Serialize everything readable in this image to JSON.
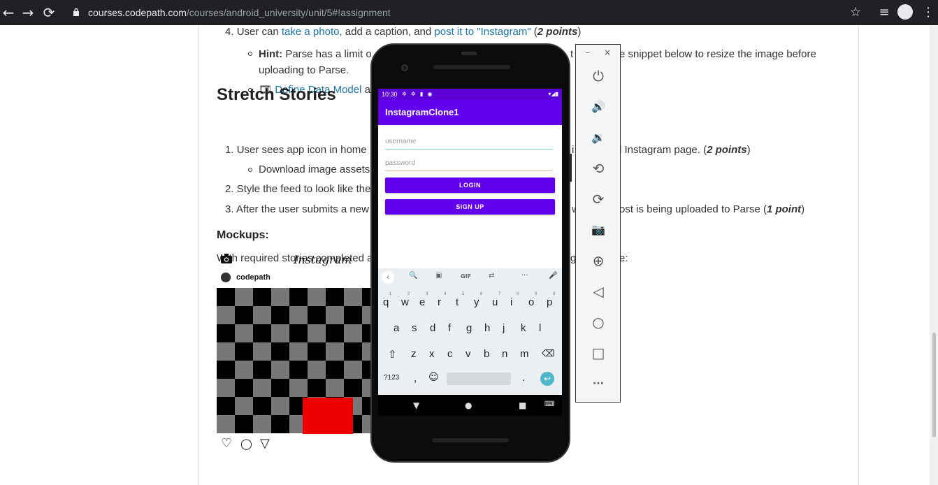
{
  "browser": {
    "back_icon": "←",
    "forward_icon": "→",
    "reload_icon": "⟳",
    "url_host": "courses.codepath.com",
    "url_path": "/courses/android_university/unit/5#!assignment",
    "star_icon": "☆",
    "reading_list_icon": "≡",
    "menu_icon": "⋮"
  },
  "article": {
    "item4_num": "4.",
    "item4_a": "User can",
    "item4_link1": "take a photo,",
    "item4_b": "add a caption, and",
    "item4_link2": "post it to \"Instagram\"",
    "item4_c": "(",
    "item4_points": "2 points",
    "item4_d": ")",
    "hint_label": "Hint:",
    "hint_text_a": "Parse has a limit o",
    "hint_text_b": "t",
    "hint_text_c": "e snippet below to resize the image before",
    "hint_text_line2": "uploading to Parse.",
    "define_icon": "🎞",
    "define_link": "Define Data Model",
    "define_tail": "ar",
    "stretch_heading": "Stretch Stories",
    "s1_num": "1.",
    "s1_text": "User sees app icon in home",
    "s1_mid": "i",
    "s1_tail": "l Instagram page. (",
    "s1_points": "2 points",
    "s1_close": ")",
    "s1_sub": "Download image assets",
    "s2_num": "2.",
    "s2_text": "Style the feed to look like the",
    "s3_num": "3.",
    "s3_text": "After the user submits a new",
    "s3_mid": "w",
    "s3_tail": "ost is being uploaded to Parse (",
    "s3_points": "1 point",
    "s3_close": ")",
    "mockups_label": "Mockups:",
    "mockups_text": "With required stories completed a",
    "mockups_mid": "g",
    "mockups_tail": "e:"
  },
  "instagram_mock": {
    "title": "Instagram",
    "username": "codepath",
    "heart_icon": "♡",
    "comment_icon": "◯",
    "send_icon": "▽",
    "bookmark_icon": "▮"
  },
  "phone": {
    "time": "10:30",
    "status_icons": "✲ ✲ ▮ ◉",
    "status_right": "▾◢▮",
    "app_title": "InstagramClone1",
    "username_placeholder": "username",
    "password_placeholder": "password",
    "login_label": "LOGIN",
    "signup_label": "SIGN UP",
    "kb_row1": [
      "q",
      "w",
      "e",
      "r",
      "t",
      "y",
      "u",
      "i",
      "o",
      "p"
    ],
    "kb_row1_nums": [
      "1",
      "2",
      "3",
      "4",
      "5",
      "6",
      "7",
      "8",
      "9",
      "0"
    ],
    "kb_row2": [
      "a",
      "s",
      "d",
      "f",
      "g",
      "h",
      "j",
      "k",
      "l"
    ],
    "kb_row3": [
      "z",
      "x",
      "c",
      "v",
      "b",
      "n",
      "m"
    ],
    "kb_shift": "⇧",
    "kb_del": "⌫",
    "kb_symbols": "?123",
    "kb_comma": ",",
    "kb_emoji": "☺",
    "kb_period": ".",
    "kb_enter": "↩",
    "kb_gif": "GIF",
    "kb_more": "···",
    "kb_mic": "🎤",
    "kb_search": "🔍",
    "kb_sticker": "▣",
    "kb_translate": "⇄",
    "kb_back": "‹",
    "nav_back": "▼",
    "nav_home": "●",
    "nav_recent": "■",
    "nav_kb": "⌨"
  },
  "emulator": {
    "minimize": "–",
    "close": "×",
    "power_icon": "⏻",
    "vol_up_icon": "🔊",
    "vol_down_icon": "🔉",
    "rotate_left_icon": "⟲",
    "rotate_right_icon": "⟳",
    "camera_icon": "📷",
    "zoom_icon": "⊕",
    "back_icon": "◁",
    "home_icon": "○",
    "overview_icon": "□",
    "more_icon": "···"
  }
}
